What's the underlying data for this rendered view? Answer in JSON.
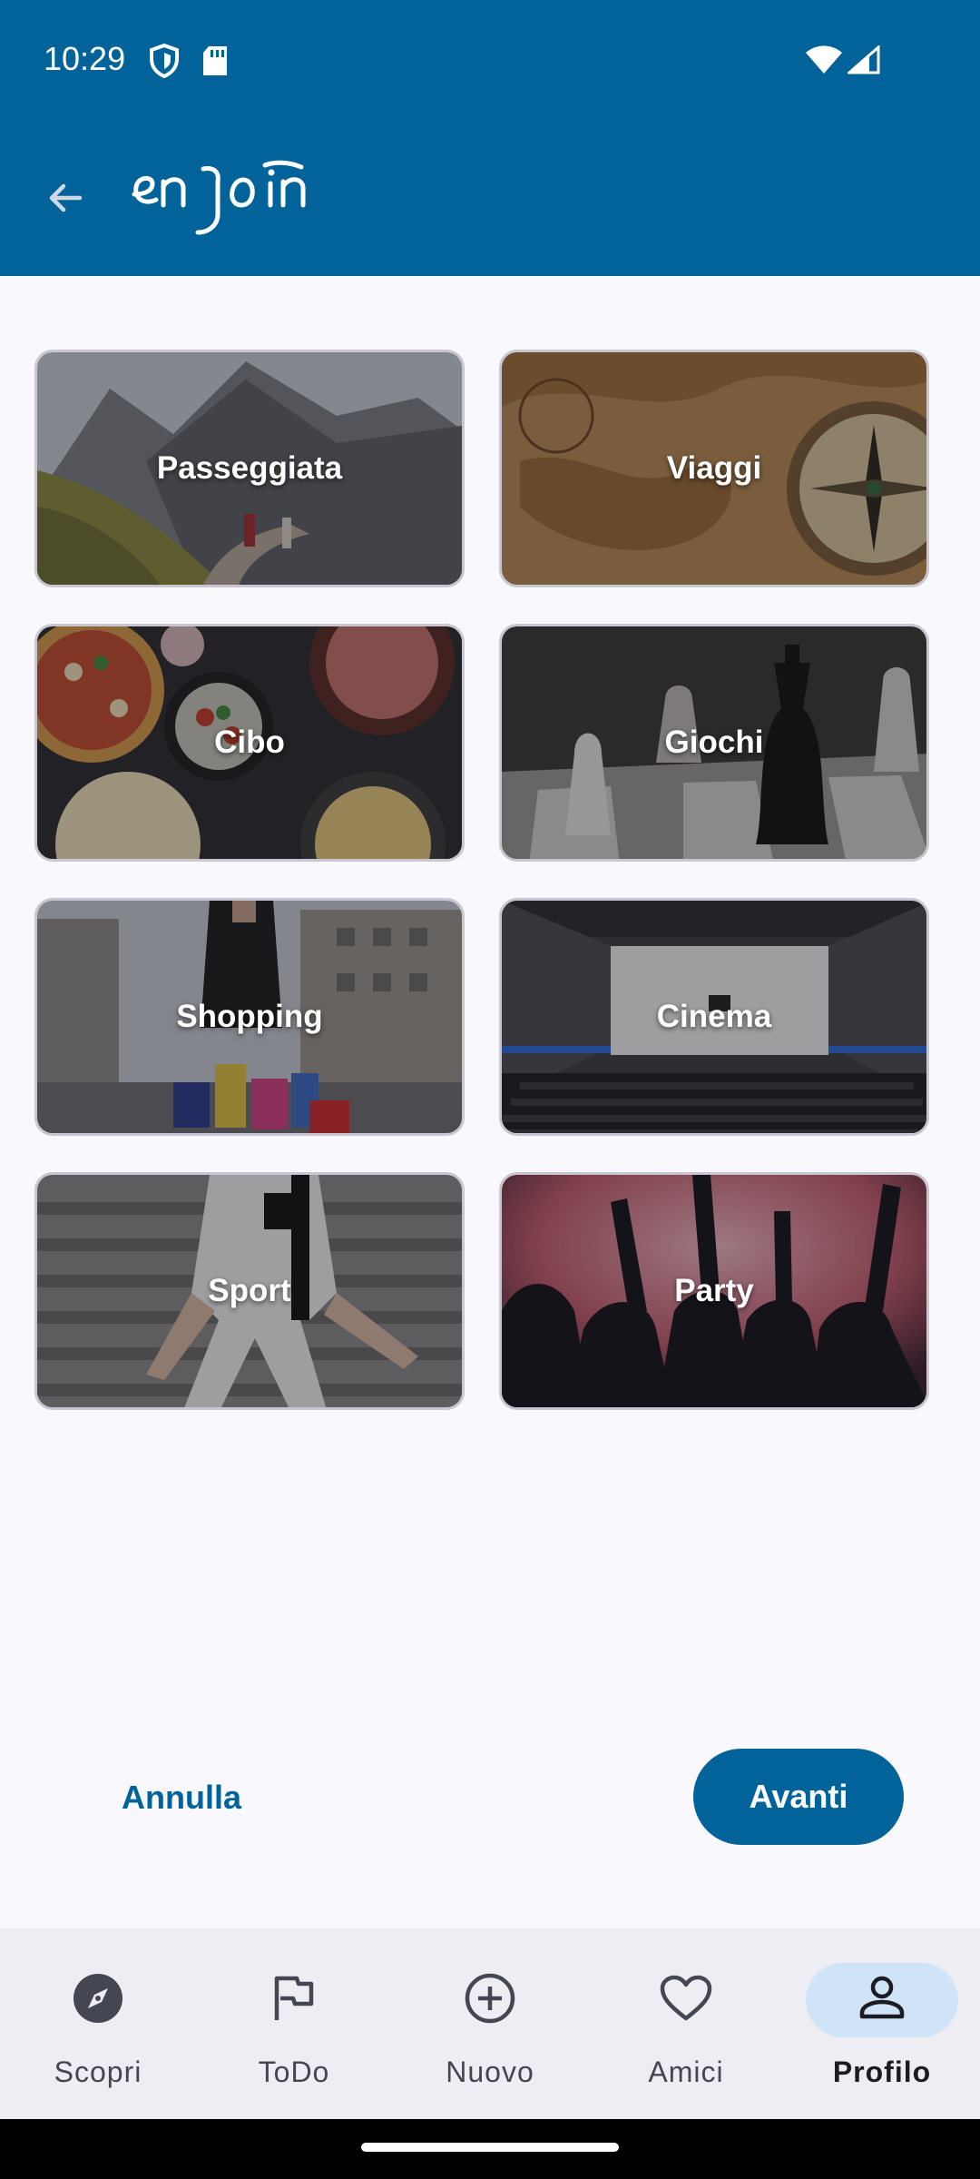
{
  "status": {
    "time": "10:29"
  },
  "colors": {
    "brand": "#02639a",
    "nav_active_bg": "#cfe4f7",
    "background": "#f9f8fd"
  },
  "app": {
    "logo_text": "enJoin"
  },
  "categories": [
    {
      "label": "Passeggiata",
      "icon": "mountain-walk-photo"
    },
    {
      "label": "Viaggi",
      "icon": "compass-map-photo"
    },
    {
      "label": "Cibo",
      "icon": "pizza-food-photo"
    },
    {
      "label": "Giochi",
      "icon": "chess-photo"
    },
    {
      "label": "Shopping",
      "icon": "shopping-bags-photo"
    },
    {
      "label": "Cinema",
      "icon": "cinema-screen-photo"
    },
    {
      "label": "Sport",
      "icon": "football-player-photo"
    },
    {
      "label": "Party",
      "icon": "party-crowd-photo"
    }
  ],
  "actions": {
    "cancel_label": "Annulla",
    "next_label": "Avanti"
  },
  "nav": [
    {
      "label": "Scopri",
      "icon": "compass-icon",
      "active": false
    },
    {
      "label": "ToDo",
      "icon": "flag-icon",
      "active": false
    },
    {
      "label": "Nuovo",
      "icon": "add-circle-icon",
      "active": false
    },
    {
      "label": "Amici",
      "icon": "heart-icon",
      "active": false
    },
    {
      "label": "Profilo",
      "icon": "person-icon",
      "active": true
    }
  ]
}
